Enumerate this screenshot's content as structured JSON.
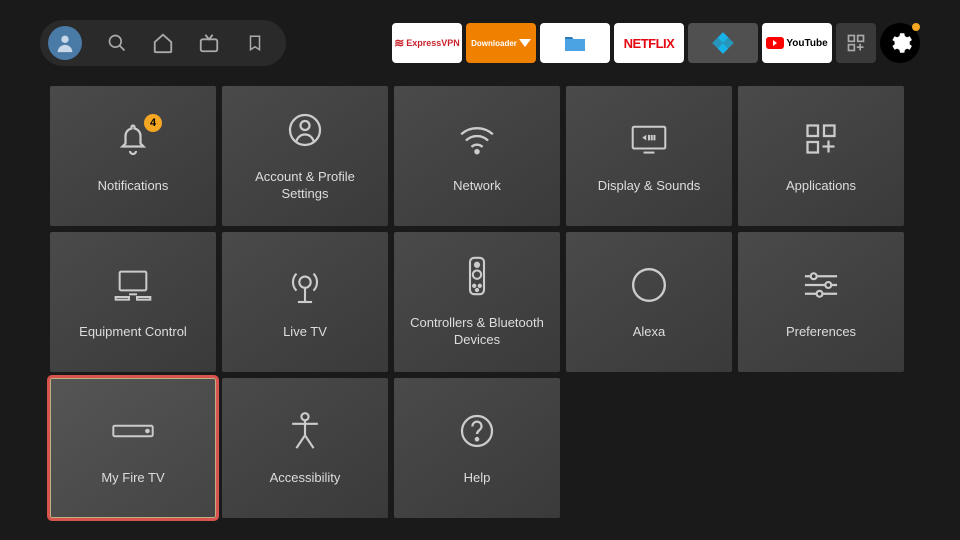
{
  "topbar": {
    "apps": {
      "expressvpn": "ExpressVPN",
      "downloader": "Downloader",
      "netflix": "NETFLIX",
      "youtube": "YouTube"
    }
  },
  "settings": {
    "cards": [
      {
        "label": "Notifications",
        "icon": "bell",
        "badge": "4"
      },
      {
        "label": "Account & Profile Settings",
        "icon": "profile"
      },
      {
        "label": "Network",
        "icon": "wifi"
      },
      {
        "label": "Display & Sounds",
        "icon": "display"
      },
      {
        "label": "Applications",
        "icon": "apps"
      },
      {
        "label": "Equipment Control",
        "icon": "equipment"
      },
      {
        "label": "Live TV",
        "icon": "livetv"
      },
      {
        "label": "Controllers & Bluetooth Devices",
        "icon": "controller"
      },
      {
        "label": "Alexa",
        "icon": "alexa"
      },
      {
        "label": "Preferences",
        "icon": "sliders"
      },
      {
        "label": "My Fire TV",
        "icon": "firetv",
        "selected": true
      },
      {
        "label": "Accessibility",
        "icon": "accessibility"
      },
      {
        "label": "Help",
        "icon": "help"
      }
    ]
  }
}
